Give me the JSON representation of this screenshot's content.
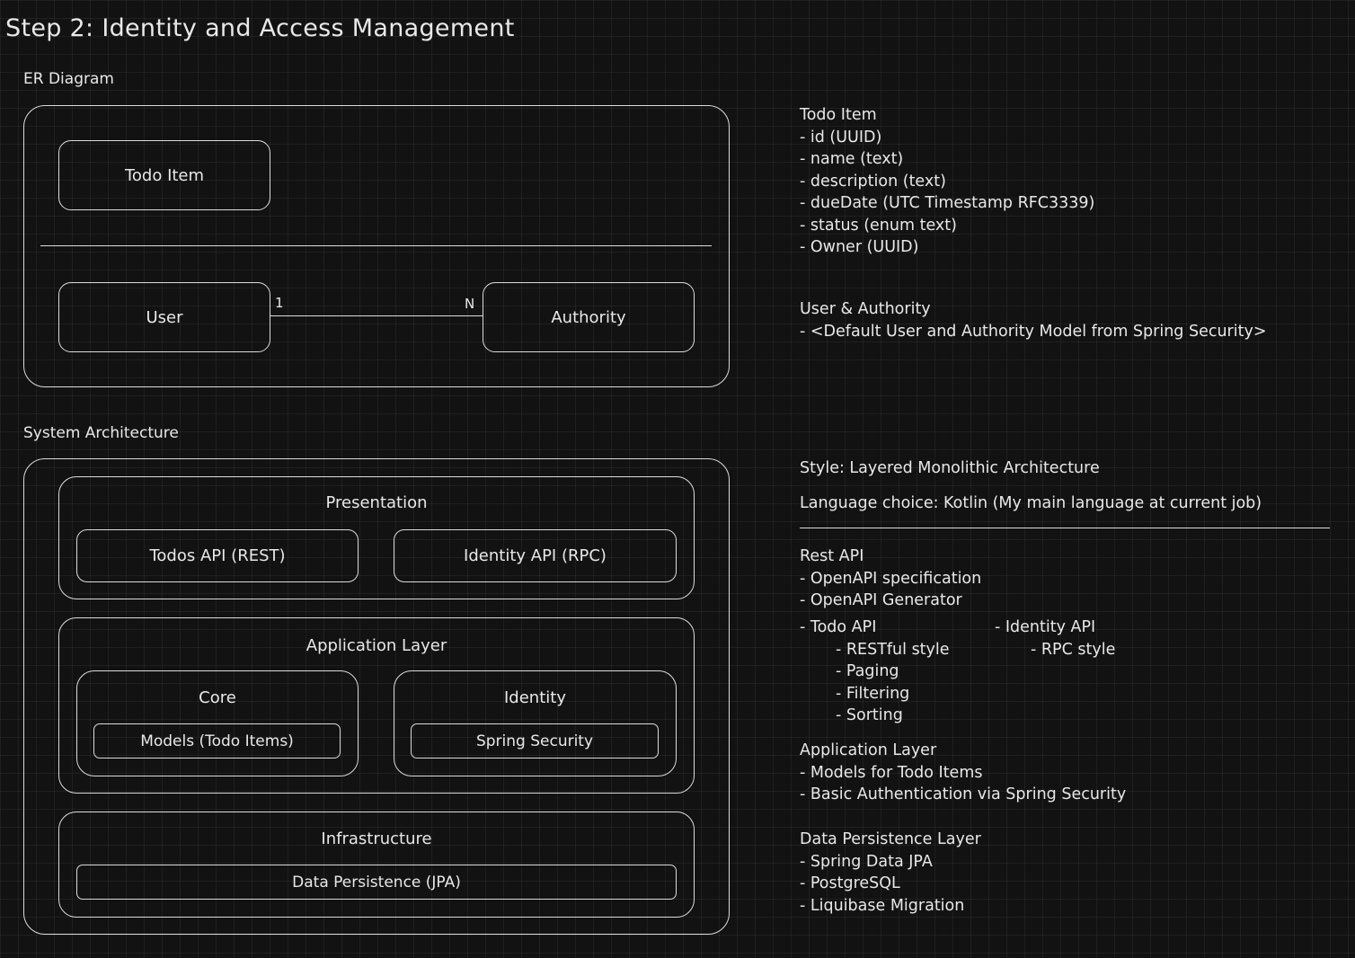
{
  "title": "Step 2: Identity and Access Management",
  "er_diagram": {
    "heading": "ER Diagram",
    "todo_item": "Todo Item",
    "user": "User",
    "authority": "Authority",
    "cardinality_left": "1",
    "cardinality_right": "N"
  },
  "system_architecture": {
    "heading": "System Architecture",
    "presentation": {
      "label": "Presentation",
      "todos_api": "Todos API (REST)",
      "identity_api": "Identity API (RPC)"
    },
    "application": {
      "label": "Application Layer",
      "core": "Core",
      "models": "Models (Todo Items)",
      "identity": "Identity",
      "spring_security": "Spring Security"
    },
    "infrastructure": {
      "label": "Infrastructure",
      "data_persistence": "Data Persistence (JPA)"
    }
  },
  "notes": {
    "todo_item": {
      "heading": "Todo Item",
      "lines": [
        "- id (UUID)",
        "- name (text)",
        "- description (text)",
        "- dueDate (UTC Timestamp RFC3339)",
        "- status (enum text)",
        "- Owner (UUID)"
      ]
    },
    "user_authority": {
      "heading": "User & Authority",
      "lines": [
        "- <Default User and Authority Model from Spring Security>"
      ]
    },
    "style": "Style: Layered Monolithic Architecture",
    "language": "Language choice: Kotlin (My main language at current job)",
    "rest_api": {
      "heading": "Rest API",
      "lines": [
        "- OpenAPI specification",
        "- OpenAPI Generator"
      ],
      "todo_api": "- Todo API",
      "todo_api_items": [
        "- RESTful style",
        "- Paging",
        "- Filtering",
        "- Sorting"
      ],
      "identity_api": "- Identity API",
      "identity_api_items": [
        "- RPC style"
      ]
    },
    "application_layer": {
      "heading": "Application Layer",
      "lines": [
        "- Models for Todo Items",
        "- Basic Authentication via Spring Security"
      ]
    },
    "data_persistence": {
      "heading": "Data Persistence Layer",
      "lines": [
        "- Spring Data JPA",
        "- PostgreSQL",
        "- Liquibase Migration"
      ]
    }
  }
}
